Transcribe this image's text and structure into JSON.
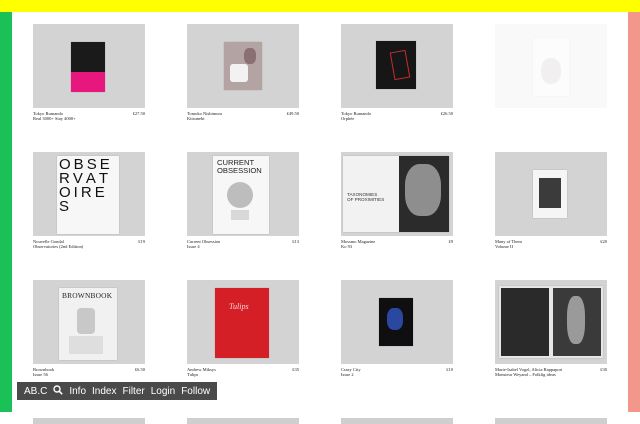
{
  "nav": {
    "logo": "AB.C",
    "items": [
      "Info",
      "Index",
      "Filter",
      "Login",
      "Follow"
    ]
  },
  "products": [
    {
      "author": "Tokyo Rumando",
      "title": "Real 3000+ Stay 4000+",
      "price": "£27.50"
    },
    {
      "author": "Tomoko Nishimura",
      "title": "Kitsunebi",
      "price": "£49.50"
    },
    {
      "author": "Tokyo Rumando",
      "title": "Orphée",
      "price": "£26.50"
    },
    {
      "author": "",
      "title": "",
      "price": ""
    },
    {
      "author": "Nouvelle Gondal",
      "title": "Observatories (2nd Edition)",
      "price": "£19"
    },
    {
      "author": "Current Obsession",
      "title": "Issue 4",
      "price": "£13"
    },
    {
      "author": "Mossmo Magazine",
      "title": "Ko 93",
      "price": "£9"
    },
    {
      "author": "Many of Them",
      "title": "Volume II",
      "price": "£20"
    },
    {
      "author": "Brownbook",
      "title": "Issue 56",
      "price": "£6.50"
    },
    {
      "author": "Andrew Miksys",
      "title": "Tulips",
      "price": "£35"
    },
    {
      "author": "Crazy City",
      "title": "Issue 2",
      "price": "£10"
    },
    {
      "author": "Marie-Isabel Vogel, Alicia Rappaport",
      "title": "Monsieur Weyand – Folklig ideas",
      "price": "£30"
    }
  ],
  "covers": {
    "observatories": [
      "O",
      "B",
      "S",
      "E",
      "R",
      "V",
      "A",
      "T",
      "O",
      "I",
      "R",
      "E",
      "S"
    ],
    "current_obsession": [
      "CURRENT",
      "OBSESSION"
    ],
    "brownbook": "BROWNBOOK",
    "tulips": "Tulips",
    "taxonomies": [
      "TAXONOMIES",
      "OF PROXIMITIES"
    ]
  },
  "colors": {
    "top_bar": "#ffff00",
    "left_bar": "#19c156",
    "right_bar": "#f3968c",
    "nav_bg": "#4a4a4a",
    "thumb_bg": "#d3d3d3"
  }
}
